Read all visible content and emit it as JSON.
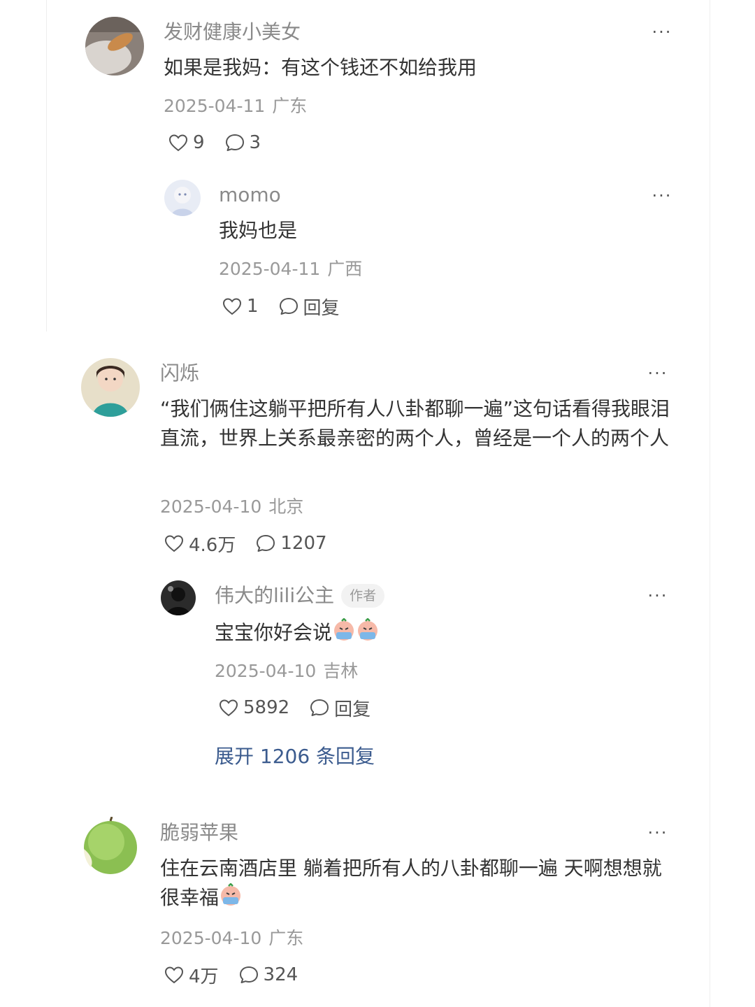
{
  "comments": [
    {
      "user": "发财健康小美女",
      "text": "如果是我妈：有这个钱还不如给我用",
      "date": "2025-04-11",
      "location": "广东",
      "likes": "9",
      "replies": "3",
      "sub_reply": {
        "user": "momo",
        "text": "我妈也是",
        "date": "2025-04-11",
        "location": "广西",
        "likes": "1",
        "reply_label": "回复"
      }
    },
    {
      "user": "闪烁",
      "text": "“我们俩住这躺平把所有人八卦都聊一遍”这句话看得我眼泪直流，世界上关系最亲密的两个人，曾经是一个人的两个人",
      "date": "2025-04-10",
      "location": "北京",
      "likes": "4.6万",
      "replies": "1207",
      "sub_reply": {
        "user": "伟大的lili公主",
        "badge": "作者",
        "text": "宝宝你好会说",
        "date": "2025-04-10",
        "location": "吉林",
        "likes": "5892",
        "reply_label": "回复"
      },
      "expand_label": "展开 1206 条回复"
    },
    {
      "user": "脆弱苹果",
      "text": "住在云南酒店里 躺着把所有人的八卦都聊一遍 天啊想想就很幸福",
      "date": "2025-04-10",
      "location": "广东",
      "likes": "4万",
      "replies": "324"
    }
  ],
  "icons": {
    "like": "heart-outline-icon",
    "comment": "speech-bubble-icon",
    "more": "more-dots-icon",
    "emoji": "crying-face-emoji"
  },
  "colors": {
    "link": "#3b5b8e",
    "meta": "#999999",
    "username": "#8a8a8a"
  },
  "more_glyph": "···"
}
